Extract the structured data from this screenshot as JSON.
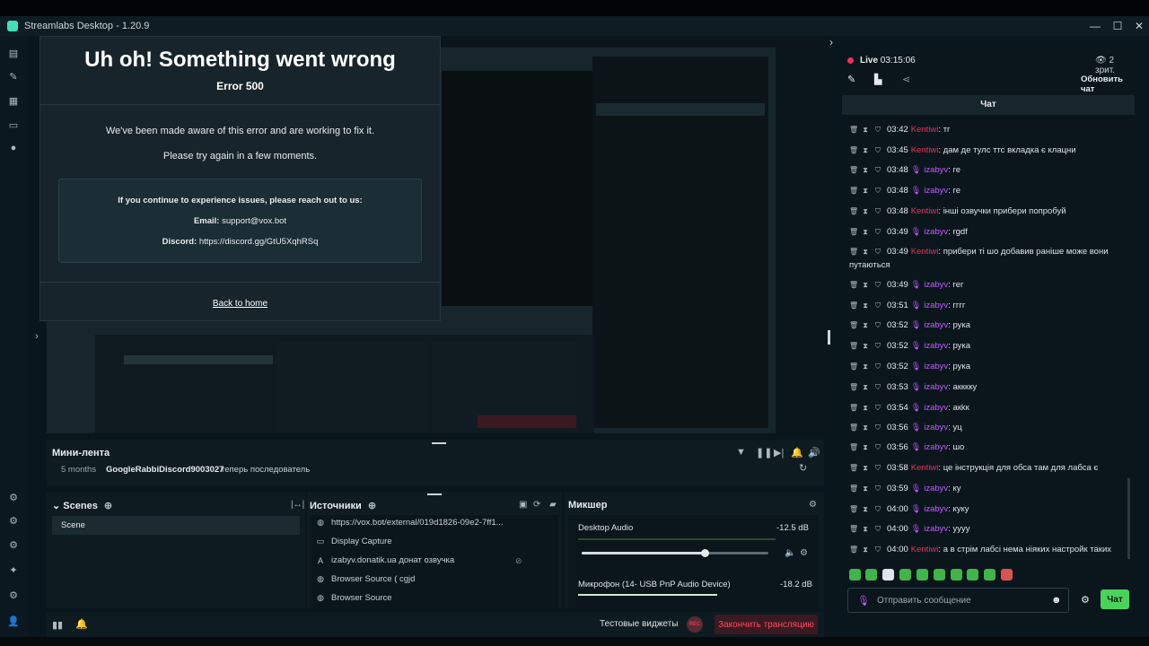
{
  "window": {
    "title": "Streamlabs Desktop - 1.20.9",
    "minimize": "—",
    "maximize": "☐",
    "close": "✕"
  },
  "error_dialog": {
    "heading": "Uh oh! Something went wrong",
    "code": "Error 500",
    "message1": "We've been made aware of this error and are working to fix it.",
    "message2": "Please try again in a few moments.",
    "contact_heading": "If you continue to experience issues, please reach out to us:",
    "email_label": "Email:",
    "email_value": "support@vox.bot",
    "discord_label": "Discord:",
    "discord_value": "https://discord.gg/GtU5XqhRSq",
    "back_link": "Back to home"
  },
  "mini_feed": {
    "title": "Мини-лента",
    "time": "5 months",
    "user": "GoogleRabbiDiscord9003027",
    "action": "теперь последователь"
  },
  "scenes": {
    "title": "Scenes",
    "items": [
      "Scene"
    ]
  },
  "sources": {
    "title": "Источники",
    "items": [
      {
        "icon": "globe-icon",
        "label": "https://vox.bot/external/019d1826-09e2-7ff1..."
      },
      {
        "icon": "monitor-icon",
        "label": "Display Capture"
      },
      {
        "icon": "text-icon",
        "label": "izabyv.donatik.ua донат озвучка"
      },
      {
        "icon": "globe-icon",
        "label": "Browser Source ( cgjd"
      },
      {
        "icon": "globe-icon",
        "label": "Browser Source"
      }
    ]
  },
  "mixer": {
    "title": "Микшер",
    "channels": [
      {
        "name": "Desktop Audio",
        "level": "-12.5 dB",
        "volume": 0.9
      },
      {
        "name": "Микрофон (14- USB PnP Audio Device)",
        "level": "-18.2 dB",
        "volume": 0.85
      }
    ]
  },
  "bottom_bar": {
    "test_widgets": "Тестовые виджеты",
    "rec": "REC",
    "end_stream": "Закончить трансляцию"
  },
  "live": {
    "label": "Live",
    "time": "03:15:06",
    "viewers": "2 зрит.",
    "refresh_chat": "Обновить чат"
  },
  "chat": {
    "title": "Чат",
    "messages": [
      {
        "time": "03:42",
        "user": "Kentiwi",
        "type": "k",
        "text": "тг",
        "mic": false
      },
      {
        "time": "03:45",
        "user": "Kentiwi",
        "type": "k",
        "text": "дам де тулс ттс вкладка є клацни",
        "mic": false
      },
      {
        "time": "03:48",
        "user": "izabyv",
        "type": "i",
        "text": "ге",
        "mic": true
      },
      {
        "time": "03:48",
        "user": "izabyv",
        "type": "i",
        "text": "ге",
        "mic": true
      },
      {
        "time": "03:48",
        "user": "Kentiwi",
        "type": "k",
        "text": "інші озвучки прибери попробуй",
        "mic": false
      },
      {
        "time": "03:49",
        "user": "izabyv",
        "type": "i",
        "text": "rgdf",
        "mic": true
      },
      {
        "time": "03:49",
        "user": "Kentiwi",
        "type": "k",
        "text": "прибери ті шо добавив раніше може вони путаються",
        "mic": false
      },
      {
        "time": "03:49",
        "user": "izabyv",
        "type": "i",
        "text": "гег",
        "mic": true
      },
      {
        "time": "03:51",
        "user": "izabyv",
        "type": "i",
        "text": "гггг",
        "mic": true
      },
      {
        "time": "03:52",
        "user": "izabyv",
        "type": "i",
        "text": "рука",
        "mic": true
      },
      {
        "time": "03:52",
        "user": "izabyv",
        "type": "i",
        "text": "рука",
        "mic": true
      },
      {
        "time": "03:52",
        "user": "izabyv",
        "type": "i",
        "text": "рука",
        "mic": true
      },
      {
        "time": "03:53",
        "user": "izabyv",
        "type": "i",
        "text": "аккккy",
        "mic": true
      },
      {
        "time": "03:54",
        "user": "izabyv",
        "type": "i",
        "text": "акkк",
        "mic": true
      },
      {
        "time": "03:56",
        "user": "izabyv",
        "type": "i",
        "text": "уц",
        "mic": true
      },
      {
        "time": "03:56",
        "user": "izabyv",
        "type": "i",
        "text": "шо",
        "mic": true
      },
      {
        "time": "03:58",
        "user": "Kentiwi",
        "type": "k",
        "text": "це інструкція для обса там для лабса є",
        "mic": false
      },
      {
        "time": "03:59",
        "user": "izabyv",
        "type": "i",
        "text": "ку",
        "mic": true
      },
      {
        "time": "04:00",
        "user": "izabyv",
        "type": "i",
        "text": "куку",
        "mic": true
      },
      {
        "time": "04:00",
        "user": "izabyv",
        "type": "i",
        "text": "уууу",
        "mic": true
      },
      {
        "time": "04:00",
        "user": "Kentiwi",
        "type": "k",
        "text": "а в стрім лабсі нема ніяких настройк таких",
        "mic": false
      }
    ],
    "input_placeholder": "Отправить сообщение",
    "send": "Чат"
  },
  "colors": {
    "accent": "#4ad35a",
    "danger": "#e8335a",
    "mention": "#c45bff",
    "bg": "#09161d"
  }
}
